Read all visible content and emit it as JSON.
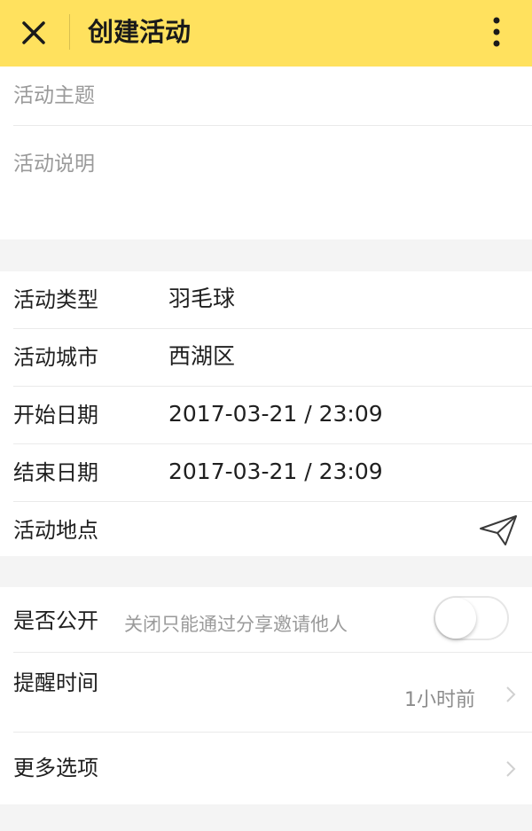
{
  "header": {
    "title": "创建活动",
    "accent_color": "#ffe15e"
  },
  "form": {
    "theme_placeholder": "活动主题",
    "description_placeholder": "活动说明"
  },
  "info": {
    "rows": [
      {
        "label": "活动类型",
        "value": "羽毛球"
      },
      {
        "label": "活动城市",
        "value": "西湖区"
      },
      {
        "label": "开始日期",
        "value": "2017-03-21 / 23:09"
      },
      {
        "label": "结束日期",
        "value": "2017-03-21 / 23:09"
      },
      {
        "label": "活动地点",
        "value": "",
        "icon": "send-icon"
      }
    ]
  },
  "options": {
    "public": {
      "label": "是否公开",
      "hint": "关闭只能通过分享邀请他人",
      "enabled": false
    },
    "reminder": {
      "label": "提醒时间",
      "value": "1小时前"
    },
    "more": {
      "label": "更多选项"
    }
  },
  "icons": {
    "close": "close-icon",
    "more": "more-vertical-icon",
    "location": "send-icon",
    "chevron": "chevron-right-icon"
  }
}
